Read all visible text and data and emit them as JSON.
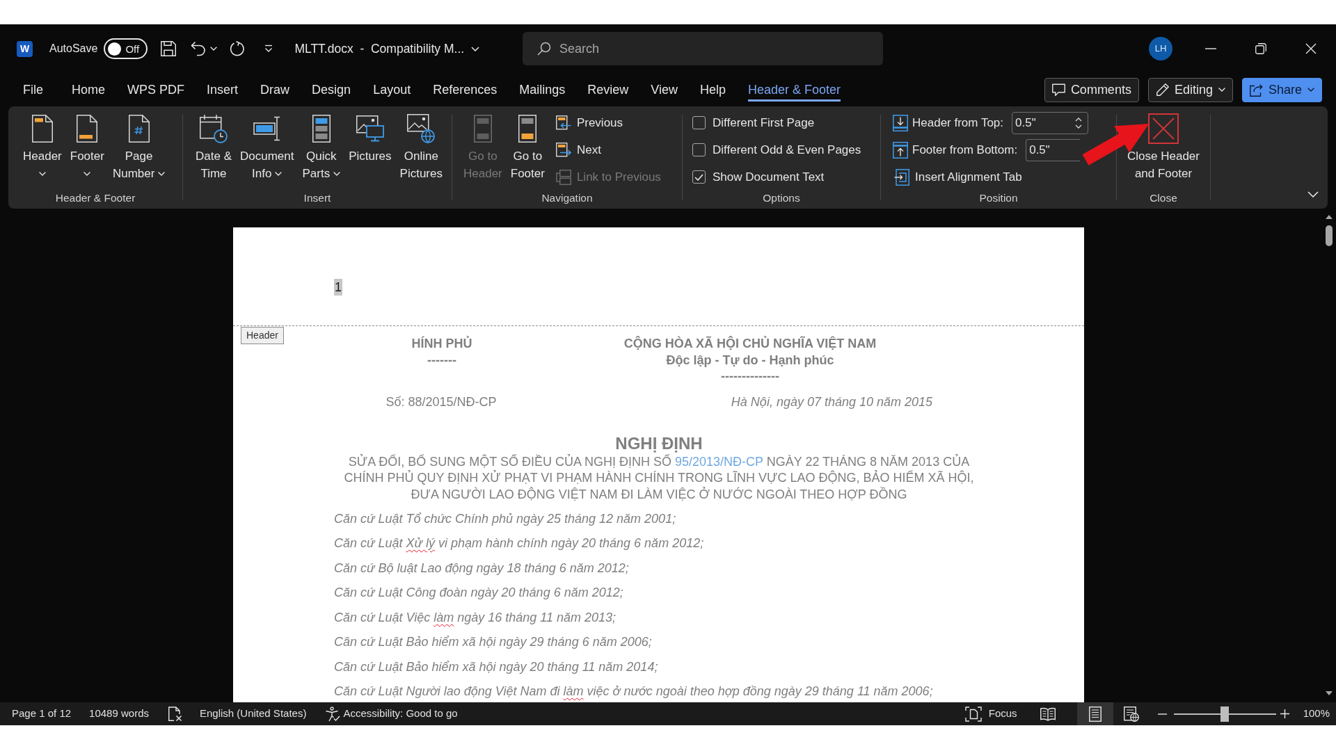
{
  "title_bar": {
    "app_logo": "W",
    "autosave_label": "AutoSave",
    "autosave": {
      "on": false,
      "label": "Off"
    },
    "document_title": "MLTT.docx  -  Compatibility M...",
    "search": {
      "placeholder": "Search"
    },
    "avatar": "LH"
  },
  "menu_tabs": [
    {
      "label": "File",
      "selected": false
    },
    {
      "label": "Home",
      "selected": false
    },
    {
      "label": "WPS PDF",
      "selected": false
    },
    {
      "label": "Insert",
      "selected": false
    },
    {
      "label": "Draw",
      "selected": false
    },
    {
      "label": "Design",
      "selected": false
    },
    {
      "label": "Layout",
      "selected": false
    },
    {
      "label": "References",
      "selected": false
    },
    {
      "label": "Mailings",
      "selected": false
    },
    {
      "label": "Review",
      "selected": false
    },
    {
      "label": "View",
      "selected": false
    },
    {
      "label": "Help",
      "selected": false
    },
    {
      "label": "Header & Footer",
      "selected": true
    }
  ],
  "menu_actions": [
    {
      "label": "Comments",
      "dropdown": false,
      "primary": false
    },
    {
      "label": "Editing",
      "dropdown": true,
      "primary": false
    },
    {
      "label": "Share",
      "dropdown": true,
      "primary": true
    }
  ],
  "ribbon_groups": [
    {
      "label": "Header & Footer",
      "items": [
        {
          "kind": "large",
          "label": [
            "Header"
          ],
          "dropdown": true,
          "disabled": false
        },
        {
          "kind": "large",
          "label": [
            "Footer"
          ],
          "dropdown": true,
          "disabled": false
        },
        {
          "kind": "large",
          "label": [
            "Page",
            "Number"
          ],
          "dropdown": true,
          "disabled": false
        }
      ]
    },
    {
      "label": "Insert",
      "items": [
        {
          "kind": "large",
          "label": [
            "Date &",
            "Time"
          ],
          "dropdown": false,
          "disabled": false
        },
        {
          "kind": "large",
          "label": [
            "Document",
            "Info"
          ],
          "dropdown": true,
          "disabled": false
        },
        {
          "kind": "large",
          "label": [
            "Quick",
            "Parts"
          ],
          "dropdown": true,
          "disabled": false
        },
        {
          "kind": "large",
          "label": [
            "Pictures"
          ],
          "dropdown": false,
          "disabled": false
        },
        {
          "kind": "large",
          "label": [
            "Online",
            "Pictures"
          ],
          "dropdown": false,
          "disabled": false
        }
      ]
    },
    {
      "label": "Navigation",
      "items": [
        {
          "kind": "large",
          "label": [
            "Go to",
            "Header"
          ],
          "dropdown": false,
          "disabled": true
        },
        {
          "kind": "large",
          "label": [
            "Go to",
            "Footer"
          ],
          "dropdown": false,
          "disabled": false
        },
        {
          "kind": "small",
          "label": "Previous",
          "disabled": false
        },
        {
          "kind": "small",
          "label": "Next",
          "disabled": false
        },
        {
          "kind": "small",
          "label": "Link to Previous",
          "disabled": true
        }
      ]
    },
    {
      "label": "Options",
      "items": [
        {
          "kind": "checkbox",
          "label": "Different First Page",
          "checked": false
        },
        {
          "kind": "checkbox",
          "label": "Different Odd & Even Pages",
          "checked": false
        },
        {
          "kind": "checkbox",
          "label": "Show Document Text",
          "checked": true
        }
      ]
    },
    {
      "label": "Position",
      "items": [
        {
          "kind": "spin",
          "label": "Header from Top:",
          "value": "0.5\""
        },
        {
          "kind": "spin",
          "label": "Footer from Bottom:",
          "value": "0.5\""
        },
        {
          "kind": "small",
          "label": "Insert Alignment Tab",
          "disabled": false
        }
      ]
    },
    {
      "label": "Close",
      "items": [
        {
          "kind": "large",
          "label": [
            "Close Header",
            "and Footer"
          ],
          "dropdown": false,
          "disabled": false
        }
      ]
    }
  ],
  "document": {
    "header_text": "1",
    "header_tag": "Header",
    "letterhead_left": [
      "HÍNH PHỦ",
      "-------"
    ],
    "letterhead_right": [
      "CỘNG HÒA XÃ HỘI CHỦ NGHĨA VIỆT NAM",
      "Độc lập - Tự do - Hạnh phúc",
      "--------------"
    ],
    "number": "Số: 88/2015/NĐ-CP",
    "place_date": "Hà Nội, ngày 07 tháng 10 năm 2015",
    "title": "NGHỊ ĐỊNH",
    "subtitle_lines": [
      {
        "segments": [
          {
            "kind": "text",
            "text": "SỬA ĐỔI, BỔ SUNG MỘT SỐ ĐIỀU CỦA NGHỊ ĐỊNH SỐ "
          },
          {
            "kind": "link",
            "text": "95/2013/NĐ-CP"
          },
          {
            "kind": "text",
            "text": " NGÀY 22 THÁNG 8 NĂM 2013 CỦA"
          }
        ]
      },
      {
        "segments": [
          {
            "kind": "text",
            "text": "CHÍNH PHỦ QUY ĐỊNH XỬ PHẠT VI PHẠM HÀNH CHÍNH TRONG LĨNH VỰC LAO ĐỘNG, BẢO HIỂM XÃ HỘI,"
          }
        ]
      },
      {
        "segments": [
          {
            "kind": "text",
            "text": "ĐƯA NGƯỜI LAO ĐỘNG VIỆT NAM ĐI LÀM VIỆC Ở NƯỚC NGOÀI THEO HỢP ĐỒNG"
          }
        ]
      }
    ],
    "paragraphs": [
      {
        "segments": [
          {
            "text": "Căn cứ Luật Tổ chức Chính phủ ngày 25 tháng 12 năm 2001;",
            "spell_error": false
          }
        ]
      },
      {
        "segments": [
          {
            "text": "Căn cứ Luật ",
            "spell_error": false
          },
          {
            "text": "Xử lý",
            "spell_error": true
          },
          {
            "text": " vi phạm hành chính ngày 20 tháng 6 năm 2012;",
            "spell_error": false
          }
        ]
      },
      {
        "segments": [
          {
            "text": "Căn cứ Bộ luật Lao động ngày 18 tháng 6 năm 2012;",
            "spell_error": false
          }
        ]
      },
      {
        "segments": [
          {
            "text": "Căn cứ Luật Công đoàn ngày 20 tháng 6 năm 2012;",
            "spell_error": false
          }
        ]
      },
      {
        "segments": [
          {
            "text": "Căn cứ Luật Việc ",
            "spell_error": false
          },
          {
            "text": "làm",
            "spell_error": true
          },
          {
            "text": " ngày 16 tháng 11 năm 2013;",
            "spell_error": false
          }
        ]
      },
      {
        "segments": [
          {
            "text": "Cân cứ Luật Bảo hiểm xã hội ngày 29 tháng 6 năm 2006;",
            "spell_error": false
          }
        ]
      },
      {
        "segments": [
          {
            "text": "Căn cứ Luật Bảo hiểm xã hội ngày 20 tháng 11 năm 2014;",
            "spell_error": false
          }
        ]
      },
      {
        "segments": [
          {
            "text": "Căn cứ Luật Người lao động Việt Nam đi ",
            "spell_error": false
          },
          {
            "text": "làm",
            "spell_error": true
          },
          {
            "text": " việc ở nước ngoài theo hợp đồng ngày 29 tháng 11 năm 2006;",
            "spell_error": false
          }
        ]
      }
    ]
  },
  "status_bar": {
    "page": "Page 1 of 12",
    "words": "10489 words",
    "language": "English (United States)",
    "accessibility": "Accessibility: Good to go",
    "focus": "Focus",
    "views": [
      {
        "selected": false
      },
      {
        "selected": true
      },
      {
        "selected": false
      }
    ],
    "zoom": {
      "level": 0.5,
      "label": "100%"
    }
  }
}
